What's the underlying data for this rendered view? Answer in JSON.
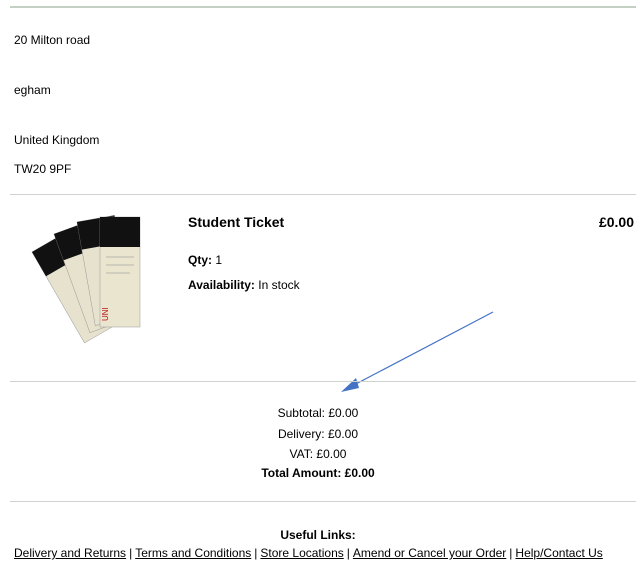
{
  "address": {
    "line1": "20 Milton road",
    "line2": "egham",
    "country": "United Kingdom",
    "postcode": "TW20 9PF"
  },
  "product": {
    "title": "Student Ticket",
    "price": "£0.00",
    "qty_label": "Qty:",
    "qty_value": "1",
    "availability_label": "Availability:",
    "availability_value": "In stock"
  },
  "totals": {
    "subtotal": "Subtotal: £0.00",
    "delivery": "Delivery: £0.00",
    "vat": "VAT: £0.00",
    "total": "Total Amount: £0.00"
  },
  "footer": {
    "title": "Useful Links:",
    "links": [
      "Delivery and Returns",
      "Terms and Conditions",
      "Store Locations",
      "Amend or Cancel your Order",
      "Help/Contact Us"
    ],
    "separator": "|"
  },
  "colors": {
    "arrow": "#4472c4",
    "rule": "#cfd3cf"
  },
  "image": {
    "logo_text": "UNI"
  }
}
